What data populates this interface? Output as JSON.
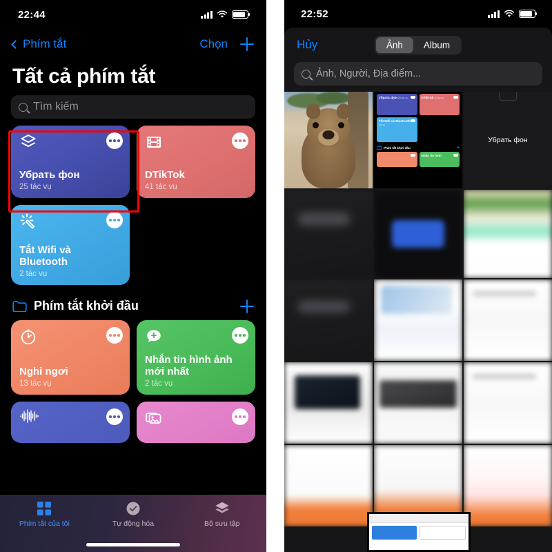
{
  "left": {
    "status": {
      "time": "22:44",
      "signal_icon": "cellular-bars-icon",
      "wifi_icon": "wifi-icon",
      "battery_icon": "battery-icon"
    },
    "nav": {
      "back_label": "Phím tắt",
      "choose_label": "Chọn",
      "add_icon": "plus-icon",
      "back_icon": "chevron-left-icon"
    },
    "title": "Tất cả phím tắt",
    "search": {
      "placeholder": "Tìm kiếm",
      "icon": "search-icon"
    },
    "all_shortcuts": [
      {
        "name": "Убрать фон",
        "tasks": "25 tác vụ",
        "icon": "layers-icon",
        "color": "#4a52b5",
        "color2": "#3f46a8",
        "selected": true
      },
      {
        "name": "DTikTok",
        "tasks": "41 tác vụ",
        "icon": "film-strip-icon",
        "color": "#e0706f",
        "color2": "#d96a6b",
        "selected": false
      },
      {
        "name": "Tắt Wifi và Bluetooth",
        "tasks": "2 tác vụ",
        "icon": "magic-wand-icon",
        "color": "#45b0ea",
        "color2": "#3da8e6",
        "selected": false
      }
    ],
    "folder": {
      "label": "Phím tắt khởi đầu",
      "icon": "folder-icon",
      "add_icon": "plus-icon"
    },
    "folder_shortcuts": [
      {
        "name": "Nghỉ ngơi",
        "tasks": "13 tác vụ",
        "icon": "timer-icon",
        "color": "#f08a6a",
        "color2": "#ea7f5f"
      },
      {
        "name": "Nhắn tin hình ảnh mới nhất",
        "tasks": "2 tác vụ",
        "icon": "message-plus-icon",
        "color": "#4cbd5c",
        "color2": "#44b455"
      },
      {
        "name": "",
        "tasks": "",
        "icon": "waveform-icon",
        "color": "#4f5ec0",
        "color2": "#4857b8"
      },
      {
        "name": "",
        "tasks": "",
        "icon": "photos-stack-icon",
        "color": "#e17ec8",
        "color2": "#dd75c3"
      }
    ],
    "tabs": [
      {
        "label": "Phím tắt của tôi",
        "icon": "grid-icon",
        "active": true
      },
      {
        "label": "Tự động hóa",
        "icon": "automation-clock-icon",
        "active": false
      },
      {
        "label": "Bộ sưu tập",
        "icon": "layers-icon",
        "active": false
      }
    ],
    "dots_icon": "more-dots-icon",
    "highlight_color": "#ff0000"
  },
  "right": {
    "status": {
      "time": "22:52",
      "signal_icon": "cellular-bars-icon",
      "wifi_icon": "wifi-icon",
      "battery_icon": "battery-icon"
    },
    "sheet": {
      "cancel_label": "Hủy",
      "segments": [
        {
          "label": "Ảnh",
          "selected": true
        },
        {
          "label": "Album",
          "selected": false
        }
      ],
      "search": {
        "placeholder": "Ảnh, Người, Địa điểm...",
        "icon": "search-icon"
      }
    },
    "photos": [
      {
        "kind": "quokka-photo",
        "label": ""
      },
      {
        "kind": "shortcuts-screenshot",
        "label": ""
      },
      {
        "kind": "dark-screenshot",
        "label": "Убрать фон"
      },
      {
        "kind": "blurred-dark",
        "label": ""
      },
      {
        "kind": "blurred-blue-card",
        "label": ""
      },
      {
        "kind": "blurred-document",
        "label": ""
      },
      {
        "kind": "blurred-web",
        "label": ""
      },
      {
        "kind": "blurred-article",
        "label": ""
      },
      {
        "kind": "blurred-list",
        "label": ""
      },
      {
        "kind": "blurred-laptop",
        "label": ""
      },
      {
        "kind": "blurred-laptop-dark",
        "label": ""
      },
      {
        "kind": "blurred-form",
        "label": ""
      },
      {
        "kind": "blurred-orange-footer",
        "label": ""
      },
      {
        "kind": "blurred-orange-footer-2",
        "label": ""
      },
      {
        "kind": "blurred-pink-footer",
        "label": ""
      }
    ],
    "mini_screenshot": {
      "cards": [
        {
          "name": "Убрать фон",
          "tasks": "25 tác vụ",
          "color": "#4a52b5"
        },
        {
          "name": "DTikTok",
          "tasks": "41 tác vụ",
          "color": "#e0706f"
        },
        {
          "name": "Tắt Wifi và Bluetooth",
          "tasks": "2 tác vụ",
          "color": "#45b0ea"
        }
      ],
      "section_label": "Phím tắt khởi đầu",
      "bottom_cards": [
        {
          "name": "",
          "color": "#f08a6a"
        },
        {
          "name": "Nhắn tin hình",
          "color": "#4cbd5c"
        }
      ]
    }
  }
}
